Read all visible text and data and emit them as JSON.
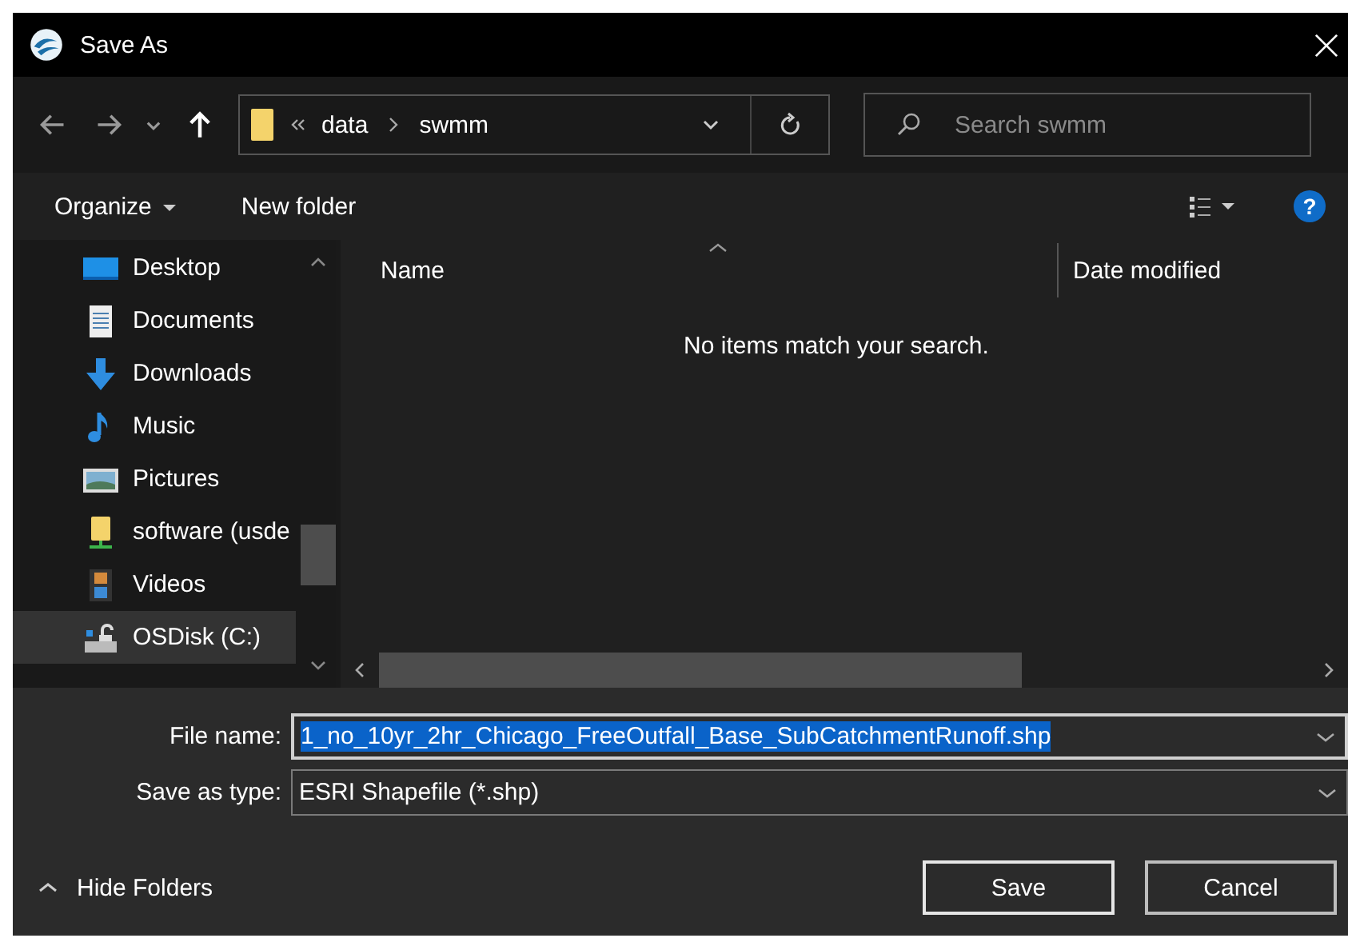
{
  "window": {
    "title": "Save As"
  },
  "nav": {
    "path": [
      "data",
      "swmm"
    ],
    "search": {
      "placeholder": "Search swmm"
    }
  },
  "toolbar": {
    "organize": "Organize",
    "new_folder": "New folder",
    "help": "?"
  },
  "sidebar": {
    "items": [
      {
        "label": "Desktop",
        "kind": "desktop",
        "selected": false
      },
      {
        "label": "Documents",
        "kind": "documents",
        "selected": false
      },
      {
        "label": "Downloads",
        "kind": "downloads",
        "selected": false
      },
      {
        "label": "Music",
        "kind": "music",
        "selected": false
      },
      {
        "label": "Pictures",
        "kind": "pictures",
        "selected": false
      },
      {
        "label": "software (usde",
        "kind": "network",
        "selected": false
      },
      {
        "label": "Videos",
        "kind": "videos",
        "selected": false
      },
      {
        "label": "OSDisk (C:)",
        "kind": "disk",
        "selected": true
      }
    ]
  },
  "table": {
    "columns": [
      "Name",
      "Date modified"
    ],
    "empty_message": "No items match your search."
  },
  "form": {
    "file_name": {
      "label": "File name:",
      "value": "1_no_10yr_2hr_Chicago_FreeOutfall_Base_SubCatchmentRunoff.shp"
    },
    "save_as_type": {
      "label": "Save as type:",
      "value": "ESRI Shapefile (*.shp)"
    }
  },
  "footer": {
    "hide_folders": "Hide Folders",
    "buttons": [
      "Save",
      "Cancel"
    ]
  }
}
